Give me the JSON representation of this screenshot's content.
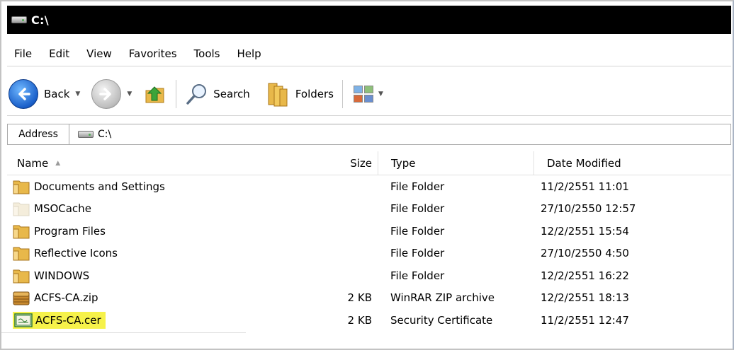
{
  "window": {
    "title": "C:\\"
  },
  "menu": [
    {
      "label": "File"
    },
    {
      "label": "Edit"
    },
    {
      "label": "View"
    },
    {
      "label": "Favorites"
    },
    {
      "label": "Tools"
    },
    {
      "label": "Help"
    }
  ],
  "toolbar": {
    "back_label": "Back",
    "search_label": "Search",
    "folders_label": "Folders"
  },
  "address": {
    "label": "Address",
    "value": "C:\\"
  },
  "columns": {
    "name": "Name",
    "size": "Size",
    "type": "Type",
    "date": "Date Modified"
  },
  "files": [
    {
      "name": "Documents and Settings",
      "size": "",
      "type": "File Folder",
      "date": "11/2/2551 11:01",
      "icon": "folder-icon"
    },
    {
      "name": "MSOCache",
      "size": "",
      "type": "File Folder",
      "date": "27/10/2550 12:57",
      "icon": "folder-hidden-icon"
    },
    {
      "name": "Program Files",
      "size": "",
      "type": "File Folder",
      "date": "12/2/2551 15:54",
      "icon": "folder-icon"
    },
    {
      "name": "Reflective Icons",
      "size": "",
      "type": "File Folder",
      "date": "27/10/2550 4:50",
      "icon": "folder-icon"
    },
    {
      "name": "WINDOWS",
      "size": "",
      "type": "File Folder",
      "date": "12/2/2551 16:22",
      "icon": "folder-icon"
    },
    {
      "name": "ACFS-CA.zip",
      "size": "2 KB",
      "type": "WinRAR ZIP archive",
      "date": "12/2/2551 18:13",
      "icon": "zip-archive-icon"
    },
    {
      "name": "ACFS-CA.cer",
      "size": "2 KB",
      "type": "Security Certificate",
      "date": "11/2/2551 12:47",
      "icon": "certificate-icon"
    }
  ],
  "colors": {
    "highlight": "#f6f24a",
    "folder": "#e8b84a",
    "back_button": "#1a5fc9"
  }
}
